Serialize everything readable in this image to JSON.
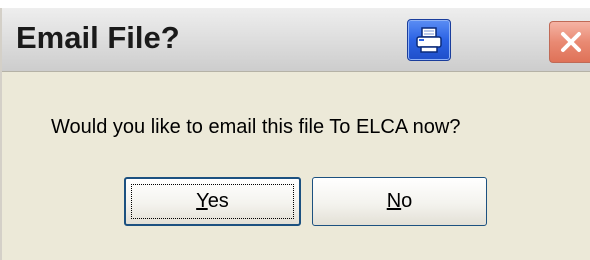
{
  "dialog": {
    "title": "Email File?",
    "message": "Would you like to email this file To ELCA now?",
    "title_bar_buttons": [
      {
        "name": "print",
        "icon": "printer-icon",
        "color": "#2b62e4"
      },
      {
        "name": "close",
        "icon": "close-icon",
        "color": "#e98a73"
      }
    ],
    "buttons": {
      "yes": {
        "mnemonic": "Y",
        "rest": "es"
      },
      "no": {
        "mnemonic": "N",
        "rest": "o"
      }
    }
  }
}
